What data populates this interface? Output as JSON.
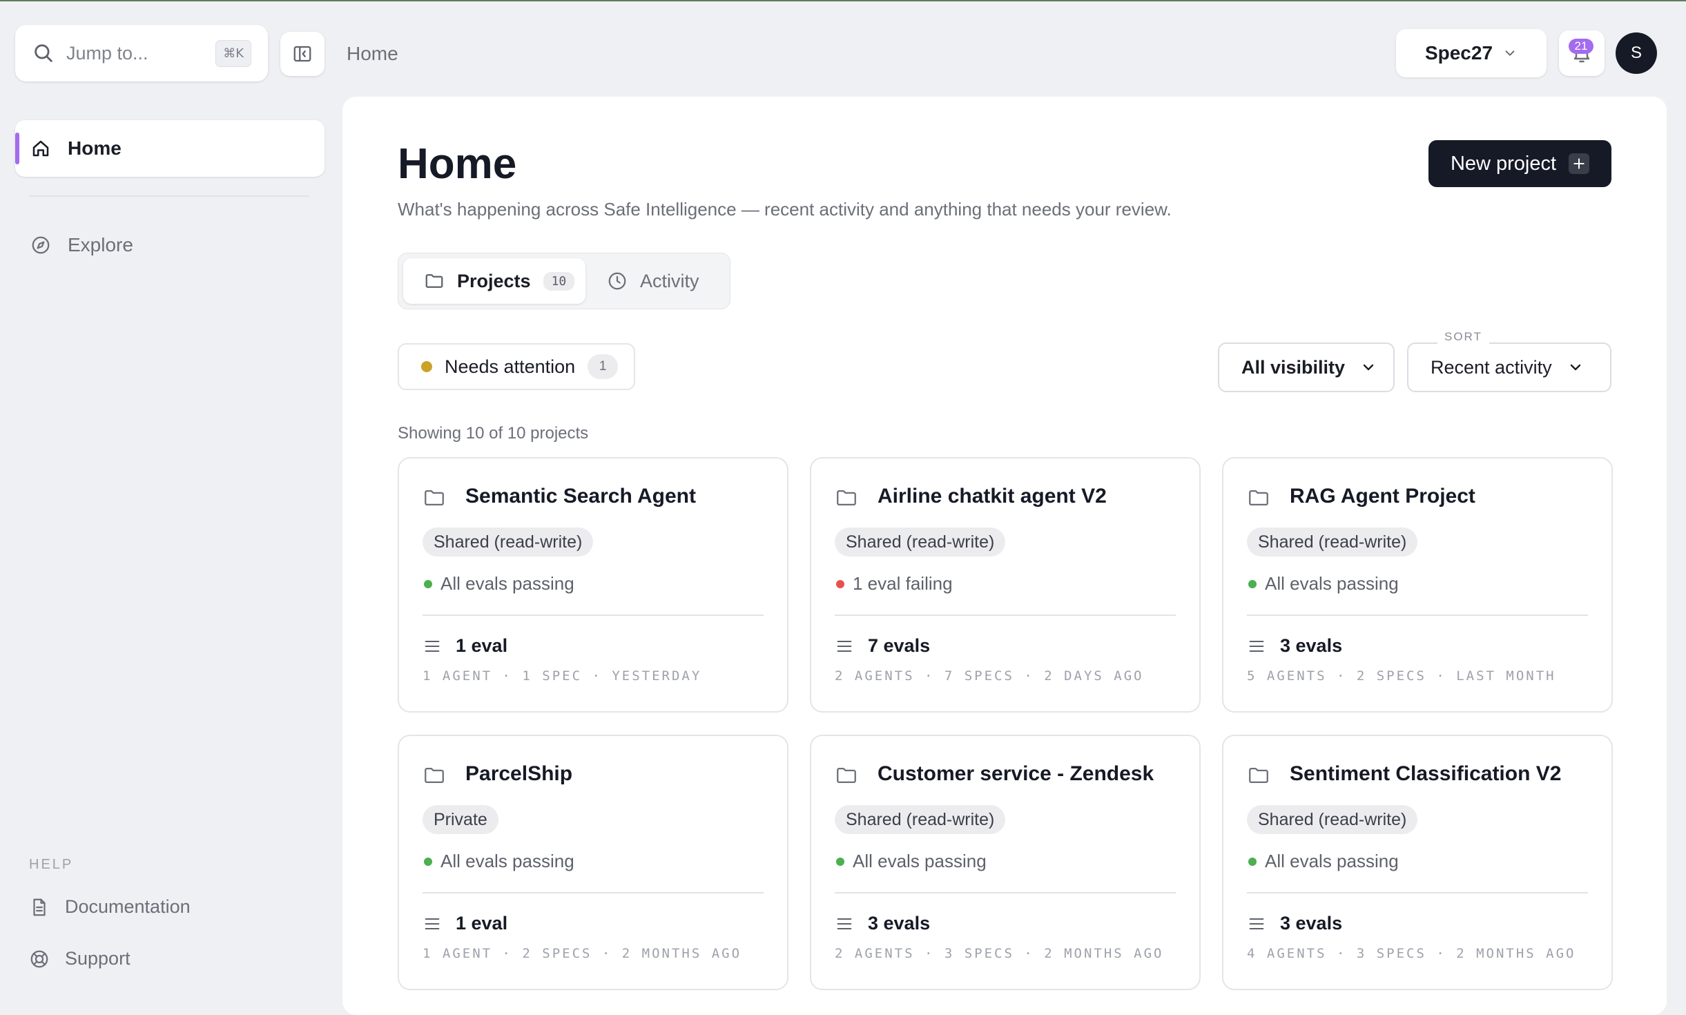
{
  "topbar": {
    "search_placeholder": "Jump to...",
    "search_shortcut": "⌘K",
    "breadcrumb": "Home",
    "org_name": "Spec27",
    "notifications_count": "21",
    "avatar_initial": "S"
  },
  "sidebar": {
    "home_label": "Home",
    "explore_label": "Explore",
    "help_heading": "HELP",
    "documentation_label": "Documentation",
    "support_label": "Support"
  },
  "main": {
    "title": "Home",
    "subtitle": "What's happening across Safe Intelligence — recent activity and anything that needs your review.",
    "new_project_label": "New project",
    "tabs": {
      "projects_label": "Projects",
      "projects_count": "10",
      "activity_label": "Activity"
    },
    "filters": {
      "needs_attention_label": "Needs attention",
      "needs_attention_count": "1",
      "visibility_label": "All visibility",
      "sort_caption": "SORT",
      "sort_label": "Recent activity"
    },
    "showing_text": "Showing 10 of 10 projects"
  },
  "projects": [
    {
      "name": "Semantic Search Agent",
      "sharing": "Shared (read-write)",
      "status": "All evals passing",
      "status_color": "#4caf50",
      "evals": "1 eval",
      "meta": "1 AGENT · 1 SPEC · YESTERDAY"
    },
    {
      "name": "Airline chatkit agent V2",
      "sharing": "Shared (read-write)",
      "status": "1 eval failing",
      "status_color": "#e5534b",
      "evals": "7 evals",
      "meta": "2 AGENTS · 7 SPECS · 2 DAYS AGO"
    },
    {
      "name": "RAG Agent Project",
      "sharing": "Shared (read-write)",
      "status": "All evals passing",
      "status_color": "#4caf50",
      "evals": "3 evals",
      "meta": "5 AGENTS · 2 SPECS · LAST MONTH"
    },
    {
      "name": "ParcelShip",
      "sharing": "Private",
      "status": "All evals passing",
      "status_color": "#4caf50",
      "evals": "1 eval",
      "meta": "1 AGENT · 2 SPECS · 2 MONTHS AGO"
    },
    {
      "name": "Customer service - Zendesk",
      "sharing": "Shared (read-write)",
      "status": "All evals passing",
      "status_color": "#4caf50",
      "evals": "3 evals",
      "meta": "2 AGENTS · 3 SPECS · 2 MONTHS AGO"
    },
    {
      "name": "Sentiment Classification V2",
      "sharing": "Shared (read-write)",
      "status": "All evals passing",
      "status_color": "#4caf50",
      "evals": "3 evals",
      "meta": "4 AGENTS · 3 SPECS · 2 MONTHS AGO"
    }
  ],
  "colors": {
    "accent": "#a36bf0",
    "primary_button": "#161a26",
    "attention_dot": "#c9a227",
    "passing": "#4caf50",
    "failing": "#e5534b"
  },
  "icons": [
    "search-icon",
    "sidebar-collapse-icon",
    "chevron-down-icon",
    "bell-icon",
    "home-icon",
    "compass-icon",
    "document-icon",
    "lifebuoy-icon",
    "plus-icon",
    "folder-icon",
    "clock-icon",
    "list-icon"
  ]
}
